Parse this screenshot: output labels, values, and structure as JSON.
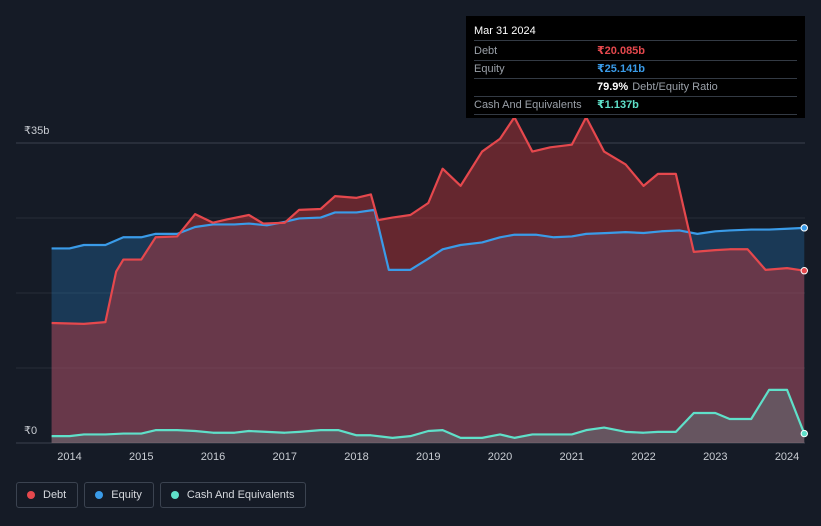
{
  "tooltip": {
    "date": "Mar 31 2024",
    "rows": [
      {
        "label": "Debt",
        "value": "₹20.085b",
        "color": "#e5484d"
      },
      {
        "label": "Equity",
        "value": "₹25.141b",
        "color": "#3a9be8"
      },
      {
        "label": "",
        "value": "79.9%",
        "suffix": "Debt/Equity Ratio",
        "color": "#ffffff"
      },
      {
        "label": "Cash And Equivalents",
        "value": "₹1.137b",
        "color": "#5fe0c9"
      }
    ]
  },
  "legend": [
    {
      "label": "Debt",
      "color": "#e5484d"
    },
    {
      "label": "Equity",
      "color": "#3a9be8"
    },
    {
      "label": "Cash And Equivalents",
      "color": "#5fe0c9"
    }
  ],
  "chart_data": {
    "type": "area",
    "title": "",
    "xlabel": "",
    "ylabel": "",
    "ylim": [
      0,
      35
    ],
    "y_tick_labels": [
      "₹35b",
      "₹0"
    ],
    "y_tick_values": [
      35,
      0
    ],
    "x_tick_labels": [
      "2014",
      "2015",
      "2016",
      "2017",
      "2018",
      "2019",
      "2020",
      "2021",
      "2022",
      "2023",
      "2024"
    ],
    "x_tick_values": [
      2014,
      2015,
      2016,
      2017,
      2018,
      2019,
      2020,
      2021,
      2022,
      2023,
      2024
    ],
    "xlim": [
      2013.7,
      2024.25
    ],
    "grid": true,
    "legend_position": "bottom-left",
    "series": [
      {
        "name": "Debt",
        "color": "#e5484d",
        "x": [
          2013.75,
          2014.2,
          2014.5,
          2014.65,
          2014.75,
          2015.0,
          2015.2,
          2015.5,
          2015.75,
          2016.0,
          2016.2,
          2016.5,
          2016.7,
          2017.0,
          2017.2,
          2017.5,
          2017.7,
          2018.0,
          2018.2,
          2018.3,
          2018.5,
          2018.75,
          2019.0,
          2019.2,
          2019.45,
          2019.75,
          2020.0,
          2020.2,
          2020.45,
          2020.7,
          2021.0,
          2021.2,
          2021.45,
          2021.75,
          2022.0,
          2022.2,
          2022.45,
          2022.7,
          2023.0,
          2023.2,
          2023.45,
          2023.7,
          2024.0,
          2024.24
        ],
        "values": [
          14.0,
          13.9,
          14.1,
          20.0,
          21.4,
          21.4,
          24.0,
          24.1,
          26.7,
          25.7,
          26.1,
          26.6,
          25.6,
          25.7,
          27.2,
          27.3,
          28.8,
          28.6,
          29.0,
          26.0,
          26.3,
          26.6,
          28.0,
          32.0,
          30.0,
          34.0,
          35.5,
          38.0,
          34.0,
          34.5,
          34.8,
          38.0,
          34.0,
          32.5,
          30.0,
          31.4,
          31.4,
          22.3,
          22.5,
          22.6,
          22.6,
          20.2,
          20.4,
          20.1
        ]
      },
      {
        "name": "Equity",
        "color": "#3a9be8",
        "x": [
          2013.75,
          2014.0,
          2014.2,
          2014.5,
          2014.75,
          2015.0,
          2015.2,
          2015.5,
          2015.75,
          2016.0,
          2016.3,
          2016.5,
          2016.75,
          2017.0,
          2017.2,
          2017.5,
          2017.7,
          2018.0,
          2018.25,
          2018.45,
          2018.75,
          2019.0,
          2019.2,
          2019.45,
          2019.75,
          2020.0,
          2020.2,
          2020.5,
          2020.75,
          2021.0,
          2021.2,
          2021.5,
          2021.75,
          2022.0,
          2022.25,
          2022.5,
          2022.75,
          2023.0,
          2023.2,
          2023.5,
          2023.75,
          2024.0,
          2024.24
        ],
        "values": [
          22.7,
          22.7,
          23.1,
          23.1,
          24.0,
          24.0,
          24.4,
          24.4,
          25.2,
          25.5,
          25.5,
          25.6,
          25.4,
          25.8,
          26.2,
          26.3,
          26.9,
          26.9,
          27.2,
          20.2,
          20.2,
          21.5,
          22.6,
          23.1,
          23.4,
          24.0,
          24.3,
          24.3,
          24.0,
          24.1,
          24.4,
          24.5,
          24.6,
          24.5,
          24.7,
          24.8,
          24.4,
          24.7,
          24.8,
          24.9,
          24.9,
          25.0,
          25.1
        ]
      },
      {
        "name": "Cash And Equivalents",
        "color": "#5fe0c9",
        "x": [
          2013.75,
          2014.0,
          2014.2,
          2014.5,
          2014.75,
          2015.0,
          2015.2,
          2015.5,
          2015.75,
          2016.0,
          2016.3,
          2016.5,
          2016.75,
          2017.0,
          2017.2,
          2017.5,
          2017.75,
          2018.0,
          2018.2,
          2018.5,
          2018.75,
          2019.0,
          2019.2,
          2019.45,
          2019.75,
          2020.0,
          2020.2,
          2020.45,
          2020.75,
          2021.0,
          2021.2,
          2021.45,
          2021.75,
          2022.0,
          2022.2,
          2022.45,
          2022.7,
          2022.85,
          2023.0,
          2023.2,
          2023.5,
          2023.75,
          2024.0,
          2024.24
        ],
        "values": [
          0.8,
          0.8,
          1.0,
          1.0,
          1.1,
          1.1,
          1.5,
          1.5,
          1.4,
          1.2,
          1.2,
          1.4,
          1.3,
          1.2,
          1.3,
          1.5,
          1.5,
          0.9,
          0.9,
          0.6,
          0.8,
          1.4,
          1.5,
          0.6,
          0.6,
          1.0,
          0.6,
          1.0,
          1.0,
          1.0,
          1.5,
          1.8,
          1.3,
          1.2,
          1.3,
          1.3,
          3.5,
          3.5,
          3.5,
          2.8,
          2.8,
          6.2,
          6.2,
          1.1
        ]
      }
    ]
  }
}
